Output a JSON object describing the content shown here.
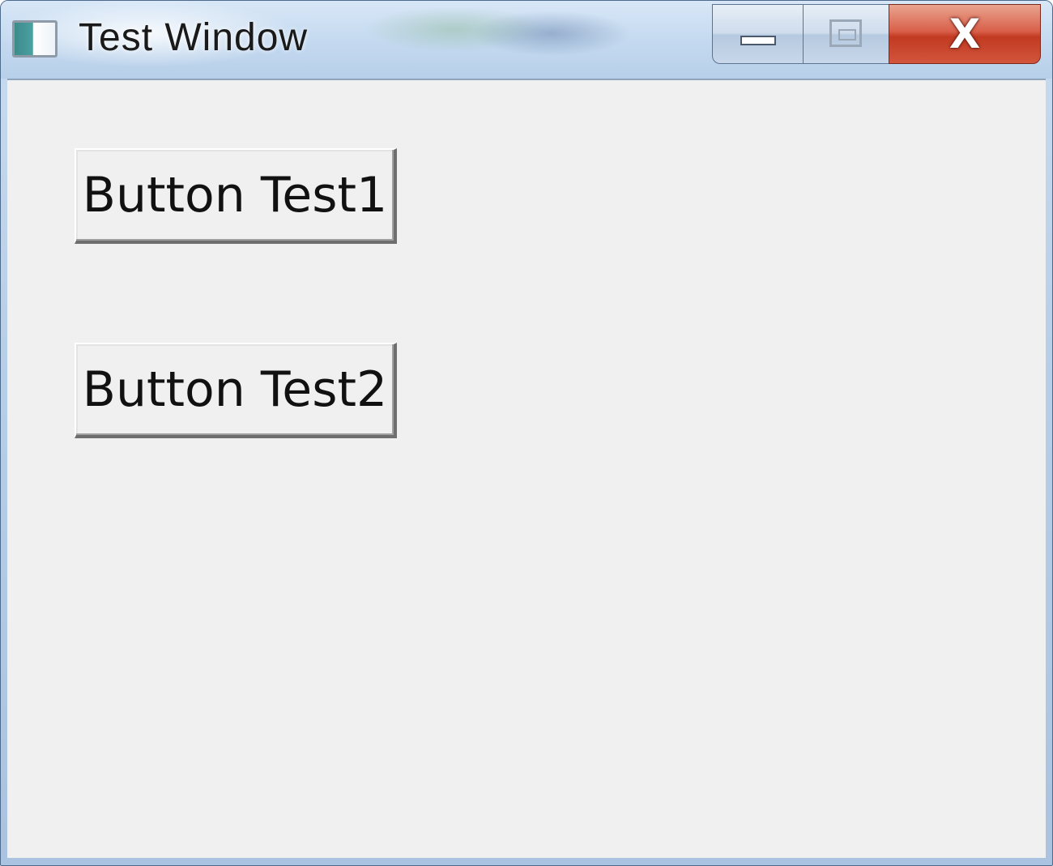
{
  "window": {
    "title": "Test Window",
    "icon": "app-window-icon"
  },
  "caption_buttons": {
    "minimize_icon": "minimize-icon",
    "maximize_icon": "maximize-icon",
    "close_glyph": "X"
  },
  "buttons": [
    {
      "label": "Button Test1"
    },
    {
      "label": "Button Test2"
    }
  ],
  "colors": {
    "client_background": "#f0f0f0",
    "close_button": "#c23a22",
    "titlebar": "#c5daf0"
  }
}
